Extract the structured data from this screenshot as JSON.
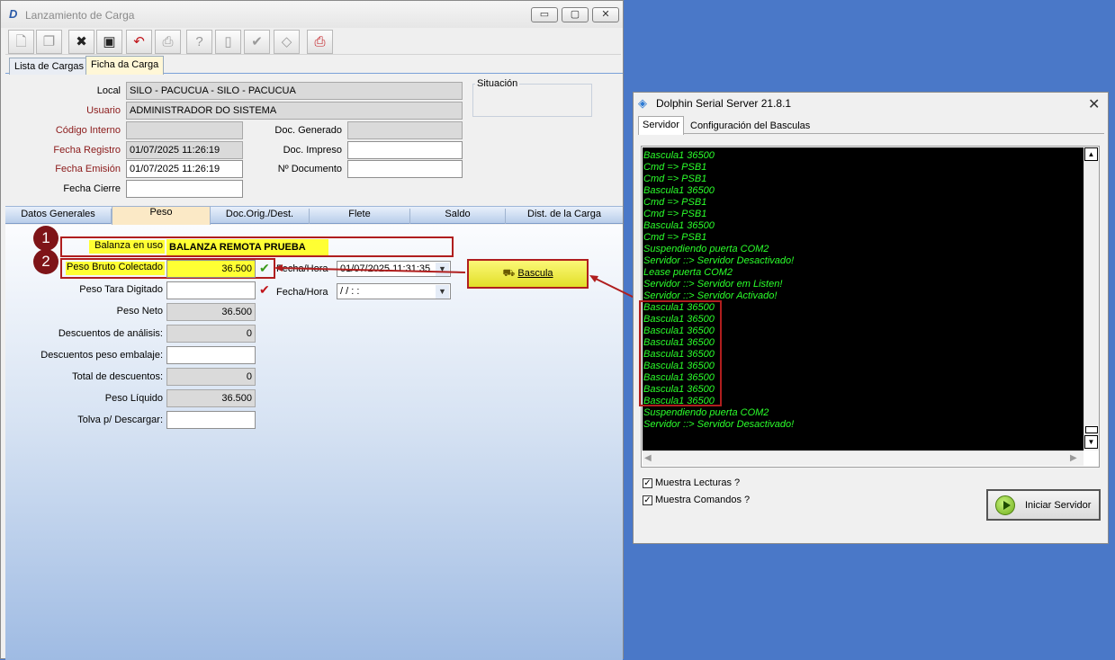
{
  "main_window": {
    "title": "Lanzamiento de Carga",
    "controls": {
      "minimize": "▭",
      "restore": "▢",
      "close": "✕"
    },
    "top_tabs": [
      "Lista de Cargas",
      "Ficha da Carga"
    ],
    "header": {
      "local_label": "Local",
      "local_value": "SILO - PACUCUA - SILO - PACUCUA",
      "usuario_label": "Usuario",
      "usuario_value": "ADMINISTRADOR DO SISTEMA",
      "situacion_label": "Situación",
      "codigo_interno_label": "Código Interno",
      "codigo_interno_value": "",
      "fecha_registro_label": "Fecha Registro",
      "fecha_registro_value": "01/07/2025 11:26:19",
      "fecha_emision_label": "Fecha Emisión",
      "fecha_emision_value": "01/07/2025 11:26:19",
      "fecha_cierre_label": "Fecha Cierre",
      "fecha_cierre_value": "",
      "doc_generado_label": "Doc. Generado",
      "doc_generado_value": "",
      "doc_impreso_label": "Doc. Impreso",
      "doc_impreso_value": "",
      "n_documento_label": "Nº Documento",
      "n_documento_value": ""
    },
    "sub_tabs": [
      "Datos Generales",
      "Peso",
      "Doc.Orig./Dest.",
      "Flete",
      "Saldo",
      "Dist. de la Carga"
    ],
    "peso": {
      "balanza_label": "Balanza en uso",
      "balanza_value": "BALANZA REMOTA PRUEBA",
      "peso_bruto_label": "Peso Bruto Colectado",
      "peso_bruto_value": "36.500",
      "fecha_hora_label": "Fecha/Hora",
      "fecha_hora_1_value": "01/07/2025 11:31:35",
      "fecha_hora_2_value": " / /       :  :",
      "peso_tara_label": "Peso Tara Digitado",
      "peso_tara_value": "",
      "peso_neto_label": "Peso Neto",
      "peso_neto_value": "36.500",
      "desc_analisis_label": "Descuentos de análisis:",
      "desc_analisis_value": "0",
      "desc_embalaje_label": "Descuentos peso embalaje:",
      "desc_embalaje_value": "",
      "total_desc_label": "Total de descuentos:",
      "total_desc_value": "0",
      "peso_liquido_label": "Peso Líquido",
      "peso_liquido_value": "36.500",
      "tolva_label": "Tolva p/ Descargar:",
      "tolva_value": "",
      "bascula_button": "Bascula",
      "badge_1": "1",
      "badge_2": "2"
    }
  },
  "serial_window": {
    "title": "Dolphin Serial Server 21.8.1",
    "tabs": [
      "Servidor",
      "Configuración del Basculas"
    ],
    "console_lines": [
      "Bascula1 36500",
      "Cmd => PSB1",
      "Cmd => PSB1",
      "Bascula1 36500",
      "Cmd => PSB1",
      "Cmd => PSB1",
      "Bascula1 36500",
      "Cmd => PSB1",
      "Suspendiendo puerta COM2",
      "Servidor ::> Servidor Desactivado!",
      "Lease puerta COM2",
      "Servidor ::> Servidor em Listen!",
      "Servidor ::> Servidor Activado!",
      "Bascula1 36500",
      "Bascula1 36500",
      "Bascula1 36500",
      "Bascula1 36500",
      "Bascula1 36500",
      "Bascula1 36500",
      "Bascula1 36500",
      "Bascula1 36500",
      "Bascula1 36500",
      "Suspendiendo puerta COM2",
      "Servidor ::> Servidor Desactivado!"
    ],
    "muestra_lecturas": "Muestra Lecturas ?",
    "muestra_comandos": "Muestra Comandos ?",
    "start_button": "Iniciar Servidor"
  }
}
